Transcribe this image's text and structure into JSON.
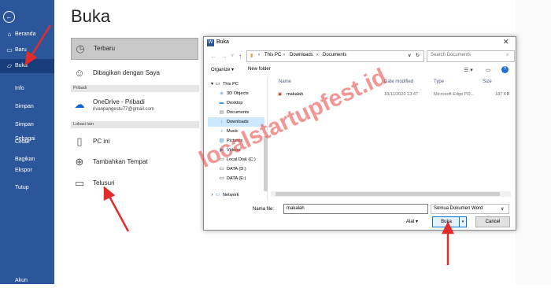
{
  "sidebar": {
    "items": [
      {
        "label": "Beranda",
        "icon": "home-icon"
      },
      {
        "label": "Baru",
        "icon": "new-doc-icon"
      },
      {
        "label": "Buka",
        "icon": "folder-open-icon",
        "selected": true
      },
      {
        "label": "Info"
      },
      {
        "label": "Simpan"
      },
      {
        "label": "Simpan Sebagai"
      },
      {
        "label": "Cetak"
      },
      {
        "label": "Bagikan"
      },
      {
        "label": "Ekspor"
      },
      {
        "label": "Tutup"
      }
    ],
    "bottom": "Akun"
  },
  "page": {
    "title": "Buka",
    "recent": "Terbaru",
    "shared": "Dibagikan dengan Saya",
    "section_personal": "Pribadi",
    "onedrive_title": "OneDrive - Pribadi",
    "onedrive_email": "rivanpangestu77@gmail.com",
    "section_other": "Lokasi lain",
    "this_pc": "PC ini",
    "add_place": "Tambahkan Tempat",
    "browse": "Telusuri"
  },
  "dialog": {
    "title": "Buka",
    "breadcrumb": [
      "This PC",
      "Downloads",
      "Documents"
    ],
    "search_placeholder": "Search Documents",
    "organize": "Organize ▾",
    "new_folder": "New folder",
    "tree": [
      "This PC",
      "3D Objects",
      "Desktop",
      "Documents",
      "Downloads",
      "Music",
      "Pictures",
      "Videos",
      "Local Disk (C:)",
      "DATA (D:)",
      "DATA (E:)",
      "Network"
    ],
    "columns": [
      "Name",
      "Date modified",
      "Type",
      "Size"
    ],
    "file": {
      "name": "makalah",
      "date": "18/11/2020 13:47",
      "type": "Microsoft Edge PD...",
      "size": "187 KB"
    },
    "file_name_label": "Nama file:",
    "file_name_value": "makalah",
    "file_type": "Semua Dokumen Word",
    "tools": "Alat",
    "open_button": "Buka",
    "cancel_button": "Cancel"
  },
  "watermark": "localstartupfest.id",
  "colors": {
    "sidebar": "#2b579a",
    "selected": "#173e7a",
    "arrow": "#e22b2b"
  }
}
